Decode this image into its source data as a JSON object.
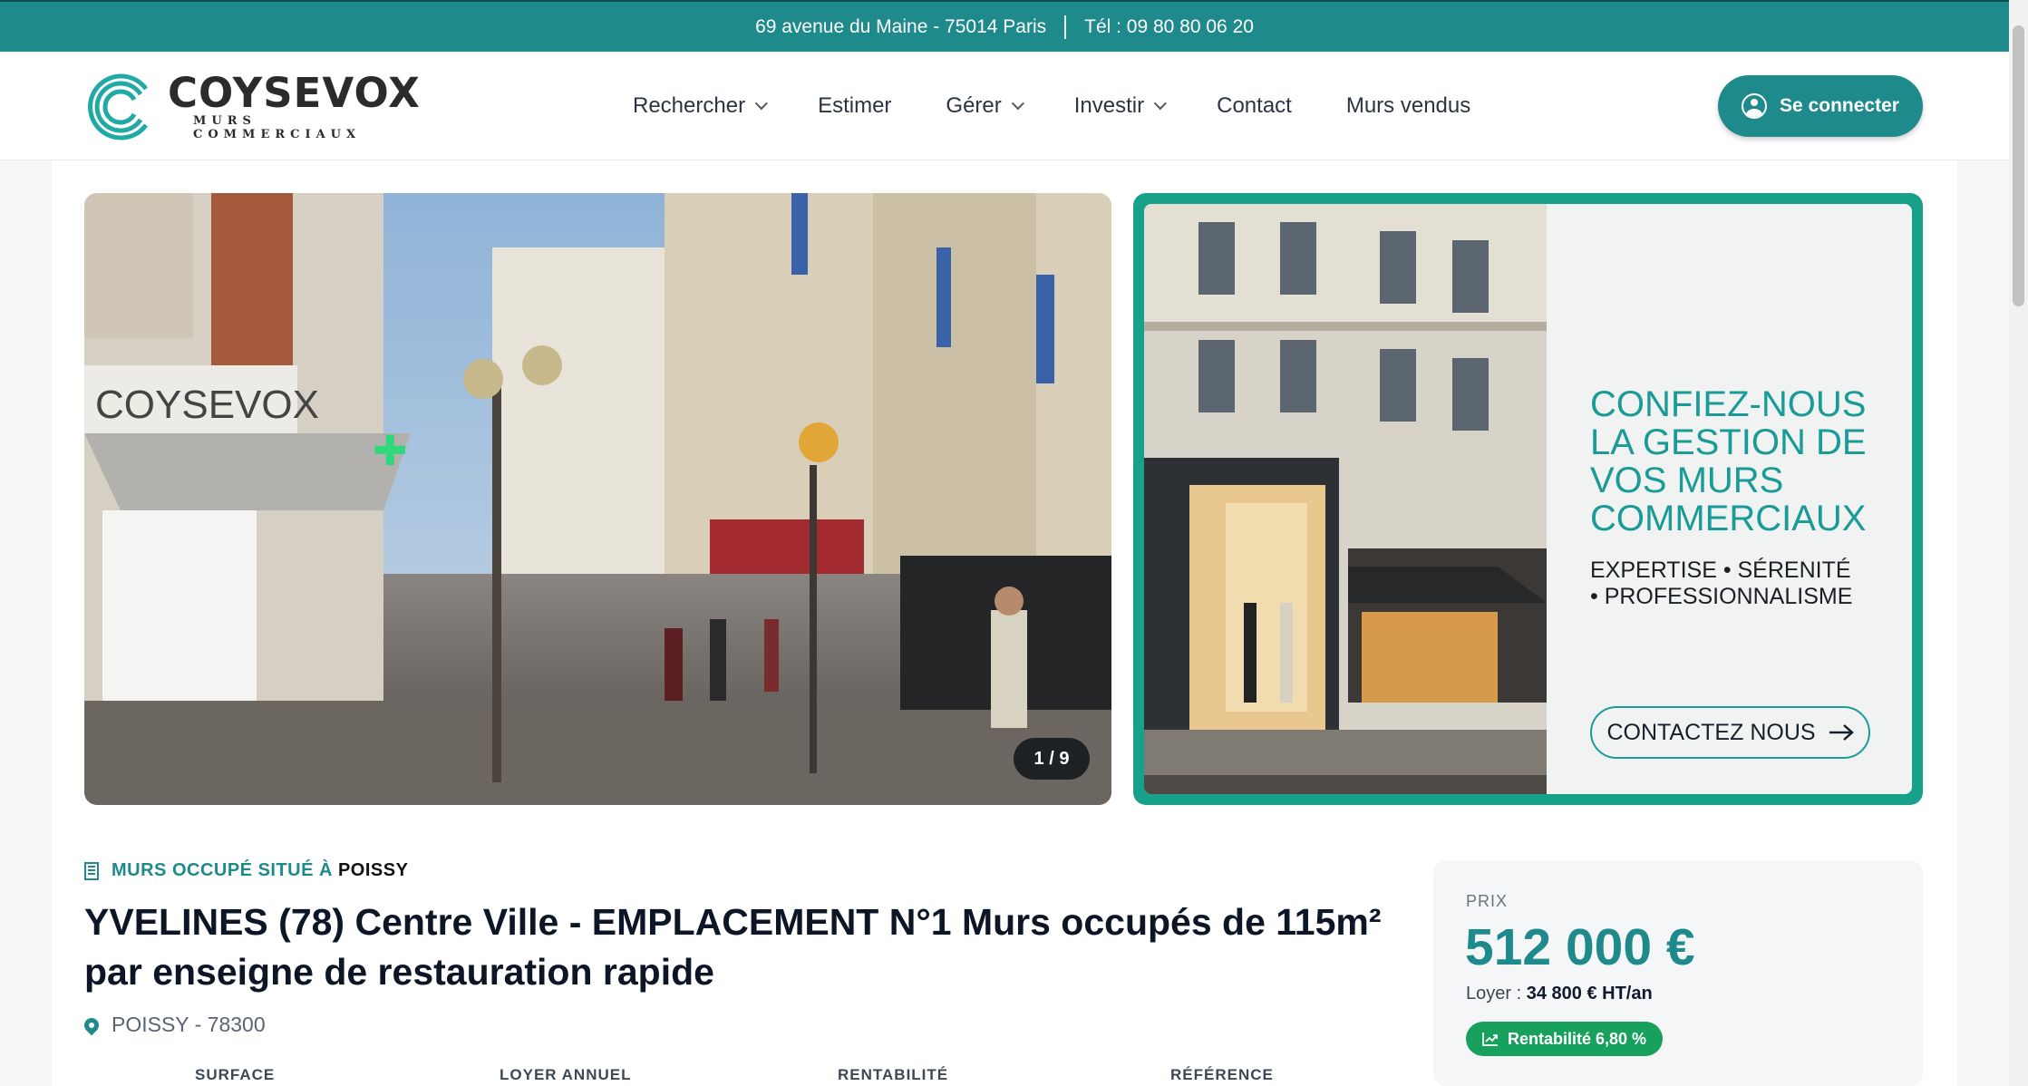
{
  "topbar": {
    "address": "69 avenue du Maine - 75014 Paris",
    "phone": "Tél : 09 80 80 06 20"
  },
  "header": {
    "logo_main": "COYSEVOX",
    "logo_sub": "MURS COMMERCIAUX",
    "nav": [
      {
        "label": "Rechercher",
        "dropdown": true
      },
      {
        "label": "Estimer",
        "dropdown": false
      },
      {
        "label": "Gérer",
        "dropdown": true
      },
      {
        "label": "Investir",
        "dropdown": true
      },
      {
        "label": "Contact",
        "dropdown": false
      },
      {
        "label": "Murs vendus",
        "dropdown": false
      }
    ],
    "login_label": "Se connecter"
  },
  "gallery": {
    "shop_sign": "COYSEVOX",
    "counter": "1 / 9"
  },
  "promo": {
    "title": "CONFIEZ-NOUS LA GESTION DE VOS MURS COMMERCIAUX",
    "tagline_1": "EXPERTISE • SÉRENITÉ",
    "tagline_2": "• PROFESSIONNALISME",
    "cta": "CONTACTEZ NOUS"
  },
  "listing": {
    "kicker": "MURS OCCUPÉ SITUÉ À",
    "kicker_city": "POISSY",
    "title": "YVELINES (78) Centre Ville - EMPLACEMENT N°1 Murs occupés de 115m² par enseigne de restauration rapide",
    "location": "POISSY - 78300",
    "facts": [
      "SURFACE",
      "LOYER ANNUEL",
      "RENTABILITÉ",
      "RÉFÉRENCE"
    ]
  },
  "price": {
    "label": "PRIX",
    "value": "512 000 €",
    "rent_label": "Loyer :",
    "rent_value": "34 800 € HT/an",
    "yield": "Rentabilité 6,80 %"
  },
  "colors": {
    "brand_teal": "#1e8a8c",
    "promo_border": "#17a08a",
    "yield_green": "#18a05d"
  }
}
